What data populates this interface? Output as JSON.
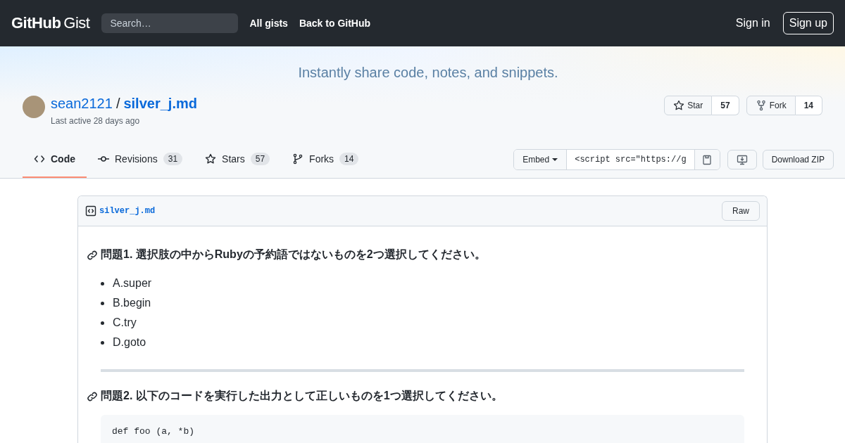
{
  "header": {
    "logo_bold": "GitHub",
    "logo_light": "Gist",
    "search": {
      "placeholder": "Search…"
    },
    "nav": [
      "All gists",
      "Back to GitHub"
    ],
    "sign_in": "Sign in",
    "sign_up": "Sign up"
  },
  "tagline": "Instantly share code, notes, and snippets.",
  "gist": {
    "owner": "sean2121",
    "separator": "/",
    "name": "silver_j.md",
    "last_active": "Last active 28 days ago",
    "star": {
      "label": "Star",
      "count": "57"
    },
    "fork": {
      "label": "Fork",
      "count": "14"
    }
  },
  "tabs": [
    {
      "kind": "code",
      "label": "Code",
      "selected": true
    },
    {
      "kind": "revisions",
      "label": "Revisions",
      "count": "31",
      "selected": false
    },
    {
      "kind": "stars",
      "label": "Stars",
      "count": "57",
      "selected": false
    },
    {
      "kind": "forks",
      "label": "Forks",
      "count": "14",
      "selected": false
    }
  ],
  "embed": {
    "label": "Embed",
    "value": "<script src=\"https://g"
  },
  "download": "Download ZIP",
  "file": {
    "name": "silver_j.md",
    "raw": "Raw",
    "blocks": [
      {
        "kind": "heading",
        "text": "問題1. 選択肢の中からRubyの予約語ではないものを2つ選択してください。"
      },
      {
        "kind": "list",
        "items": [
          "A.super",
          "B.begin",
          "C.try",
          "D.goto"
        ]
      },
      {
        "kind": "rule"
      },
      {
        "kind": "heading",
        "text": "問題2. 以下のコードを実行した出力として正しいものを1つ選択してください。"
      },
      {
        "kind": "code",
        "lines": [
          "def foo (a, *b)"
        ]
      }
    ]
  }
}
